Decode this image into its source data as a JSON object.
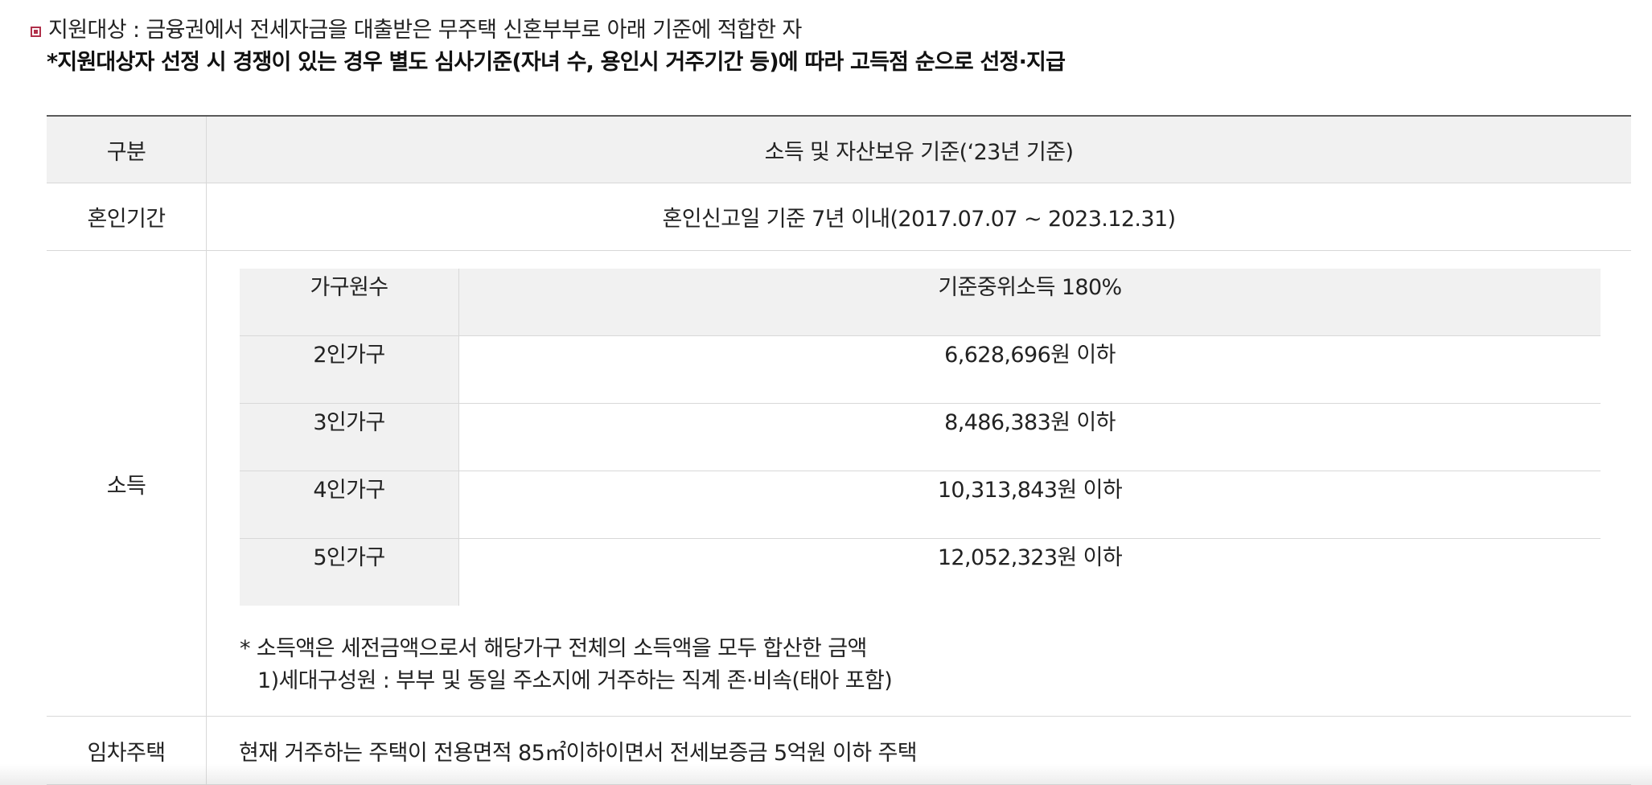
{
  "intro": {
    "line1": "지원대상 : 금융권에서 전세자금을 대출받은 무주택 신혼부부로 아래 기준에 적합한 자",
    "line2": "*지원대상자 선정 시 경쟁이 있는 경우 별도 심사기준(자녀 수, 용인시 거주기간 등)에 따라 고득점 순으로 선정·지급"
  },
  "table": {
    "header": {
      "label": "구분",
      "value": "소득 및 자산보유 기준(‘23년 기준)"
    },
    "period": {
      "label": "혼인기간",
      "value": "혼인신고일 기준 7년 이내(2017.07.07 ~ 2023.12.31)"
    },
    "income": {
      "label": "소득",
      "sub_header": {
        "col1": "가구원수",
        "col2": "기준중위소득 180%"
      },
      "rows": [
        {
          "household": "2인가구",
          "limit": "6,628,696원 이하"
        },
        {
          "household": "3인가구",
          "limit": "8,486,383원 이하"
        },
        {
          "household": "4인가구",
          "limit": "10,313,843원 이하"
        },
        {
          "household": "5인가구",
          "limit": "12,052,323원 이하"
        }
      ],
      "note1": "* 소득액은 세전금액으로서 해당가구 전체의 소득액을 모두 합산한 금액",
      "note2": "1)세대구성원 : 부부 및 동일 주소지에 거주하는 직계 존·비속(태아 포함)"
    },
    "house": {
      "label": "임차주택",
      "value": "현재 거주하는 주택이 전용면적 85㎡이하이면서 전세보증금 5억원 이하 주택"
    }
  },
  "colors": {
    "bullet": "#b0304a",
    "header_bg": "#f1f1f1",
    "border": "#d8d8d8",
    "top_border": "#5a5a5a"
  }
}
